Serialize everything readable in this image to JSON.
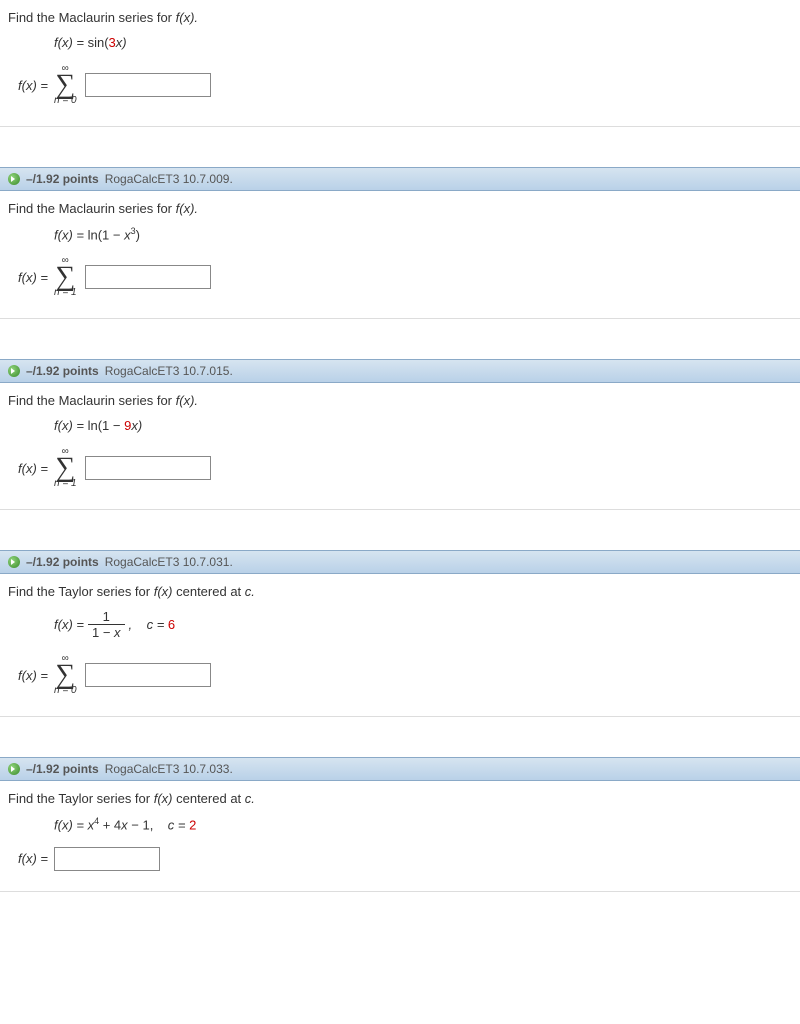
{
  "q1": {
    "prompt_pre": "Find the Maclaurin series for  ",
    "prompt_fx": "f(x).",
    "func_lhs": "f(x) = ",
    "func_rhs_a": "sin(",
    "func_rhs_b": "3",
    "func_rhs_c": "x)",
    "fx_eq": "f(x) =",
    "sigma_top": "∞",
    "sigma_bot": "n = 0"
  },
  "q2": {
    "points": "–/1.92 points",
    "source": "RogaCalcET3 10.7.009.",
    "prompt_pre": "Find the Maclaurin series for  ",
    "prompt_fx": "f(x).",
    "func_lhs": "f(x) = ",
    "func_rhs_a": "ln(1 − ",
    "func_rhs_b": "x",
    "func_rhs_c": "3",
    "func_rhs_d": ")",
    "fx_eq": "f(x) =",
    "sigma_top": "∞",
    "sigma_bot": "n = 1"
  },
  "q3": {
    "points": "–/1.92 points",
    "source": "RogaCalcET3 10.7.015.",
    "prompt_pre": "Find the Maclaurin series for  ",
    "prompt_fx": "f(x).",
    "func_lhs": "f(x) = ",
    "func_rhs_a": "ln(1 − ",
    "func_rhs_b": "9",
    "func_rhs_c": "x)",
    "fx_eq": "f(x) =",
    "sigma_top": "∞",
    "sigma_bot": "n = 1"
  },
  "q4": {
    "points": "–/1.92 points",
    "source": "RogaCalcET3 10.7.031.",
    "prompt_pre": "Find the Taylor series for  ",
    "prompt_fx": "f(x)",
    "prompt_post": "  centered at ",
    "prompt_c": "c.",
    "func_lhs": "f(x) = ",
    "frac_num": "1",
    "frac_den_a": "1 − ",
    "frac_den_b": "x",
    "comma_c": ",    c = ",
    "c_val": "6",
    "fx_eq": "f(x) =",
    "sigma_top": "∞",
    "sigma_bot": "n = 0"
  },
  "q5": {
    "points": "–/1.92 points",
    "source": "RogaCalcET3 10.7.033.",
    "prompt_pre": "Find the Taylor series for  ",
    "prompt_fx": "f(x)",
    "prompt_post": "  centered at ",
    "prompt_c": "c.",
    "func_lhs": "f(x) = ",
    "func_rhs_a": "x",
    "func_rhs_b": "4",
    "func_rhs_c": " + 4",
    "func_rhs_d": "x",
    "func_rhs_e": " − 1,    ",
    "c_lbl": "c = ",
    "c_val": "2",
    "fx_eq": "f(x) ="
  }
}
